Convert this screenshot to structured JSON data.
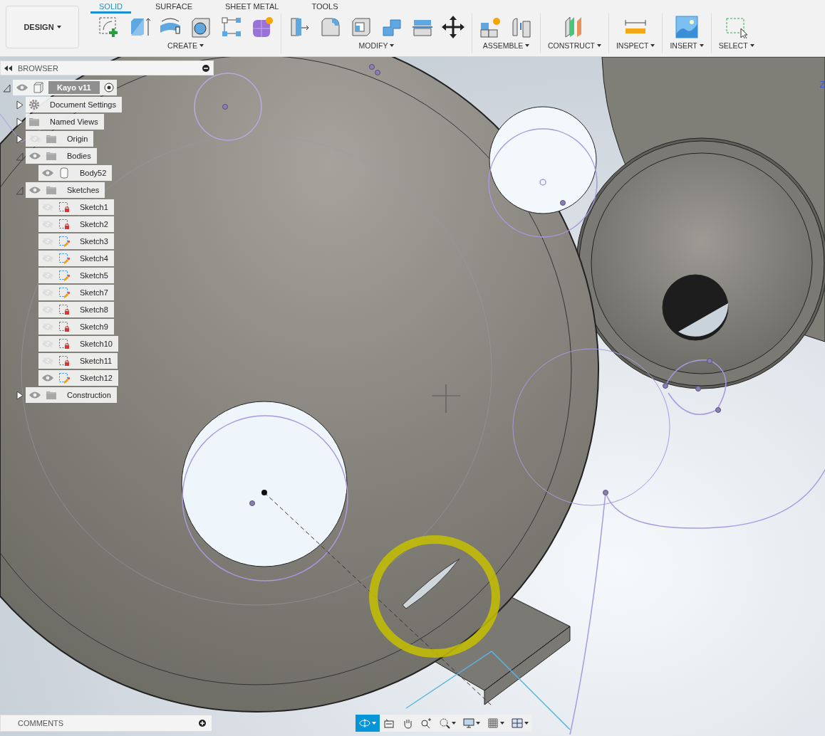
{
  "workspace": {
    "label": "DESIGN"
  },
  "tabs": [
    {
      "label": "SOLID",
      "selected": true
    },
    {
      "label": "SURFACE",
      "selected": false
    },
    {
      "label": "SHEET METAL",
      "selected": false
    },
    {
      "label": "TOOLS",
      "selected": false
    }
  ],
  "tool_groups": [
    {
      "label": "CREATE",
      "tools": [
        {
          "kind": "sketch"
        },
        {
          "kind": "extrude"
        },
        {
          "kind": "revolve"
        },
        {
          "kind": "hole"
        },
        {
          "kind": "pattern"
        },
        {
          "kind": "form"
        }
      ]
    },
    {
      "label": "MODIFY",
      "tools": [
        {
          "kind": "presspull"
        },
        {
          "kind": "fillet"
        },
        {
          "kind": "shell"
        },
        {
          "kind": "combine"
        },
        {
          "kind": "split"
        },
        {
          "kind": "move"
        }
      ]
    },
    {
      "label": "ASSEMBLE",
      "tools": [
        {
          "kind": "component"
        },
        {
          "kind": "joint"
        }
      ]
    },
    {
      "label": "CONSTRUCT",
      "tools": [
        {
          "kind": "plane"
        }
      ]
    },
    {
      "label": "INSPECT",
      "tools": [
        {
          "kind": "measure"
        }
      ]
    },
    {
      "label": "INSERT",
      "tools": [
        {
          "kind": "image"
        }
      ]
    },
    {
      "label": "SELECT",
      "tools": [
        {
          "kind": "select"
        }
      ]
    }
  ],
  "browser": {
    "title": "BROWSER",
    "tree": [
      {
        "label": "Kayo v11",
        "kind": "root",
        "visible": true,
        "expanded": true,
        "children": [
          {
            "label": "Document Settings",
            "kind": "settings",
            "expanded": false
          },
          {
            "label": "Named Views",
            "kind": "folder",
            "expanded": false
          },
          {
            "label": "Origin",
            "kind": "folder",
            "visible": false,
            "expanded": false
          },
          {
            "label": "Bodies",
            "kind": "folder",
            "visible": true,
            "expanded": true,
            "children": [
              {
                "label": "Body52",
                "kind": "body",
                "visible": true
              }
            ]
          },
          {
            "label": "Sketches",
            "kind": "folder",
            "visible": true,
            "expanded": true,
            "children": [
              {
                "label": "Sketch1",
                "kind": "sketch",
                "locked": true,
                "visible": false
              },
              {
                "label": "Sketch2",
                "kind": "sketch",
                "locked": true,
                "visible": false
              },
              {
                "label": "Sketch3",
                "kind": "sketch",
                "locked": false,
                "visible": false
              },
              {
                "label": "Sketch4",
                "kind": "sketch",
                "locked": false,
                "visible": false
              },
              {
                "label": "Sketch5",
                "kind": "sketch",
                "locked": false,
                "visible": false
              },
              {
                "label": "Sketch7",
                "kind": "sketch",
                "locked": false,
                "visible": false
              },
              {
                "label": "Sketch8",
                "kind": "sketch",
                "locked": true,
                "visible": false
              },
              {
                "label": "Sketch9",
                "kind": "sketch",
                "locked": true,
                "visible": false
              },
              {
                "label": "Sketch10",
                "kind": "sketch",
                "locked": true,
                "visible": false
              },
              {
                "label": "Sketch11",
                "kind": "sketch",
                "locked": true,
                "visible": false
              },
              {
                "label": "Sketch12",
                "kind": "sketch",
                "locked": false,
                "visible": true
              }
            ]
          },
          {
            "label": "Construction",
            "kind": "folder",
            "visible": true,
            "expanded": false
          }
        ]
      }
    ]
  },
  "axis_label": "Z",
  "comments": {
    "title": "COMMENTS"
  },
  "nav_tools": [
    {
      "kind": "orbit",
      "selected": true
    },
    {
      "kind": "look",
      "selected": false
    },
    {
      "kind": "pan",
      "selected": false
    },
    {
      "kind": "zoom",
      "selected": false
    },
    {
      "kind": "fit",
      "selected": false
    },
    {
      "kind": "display",
      "selected": false
    },
    {
      "kind": "grid",
      "selected": false
    },
    {
      "kind": "viewports",
      "selected": false
    }
  ]
}
